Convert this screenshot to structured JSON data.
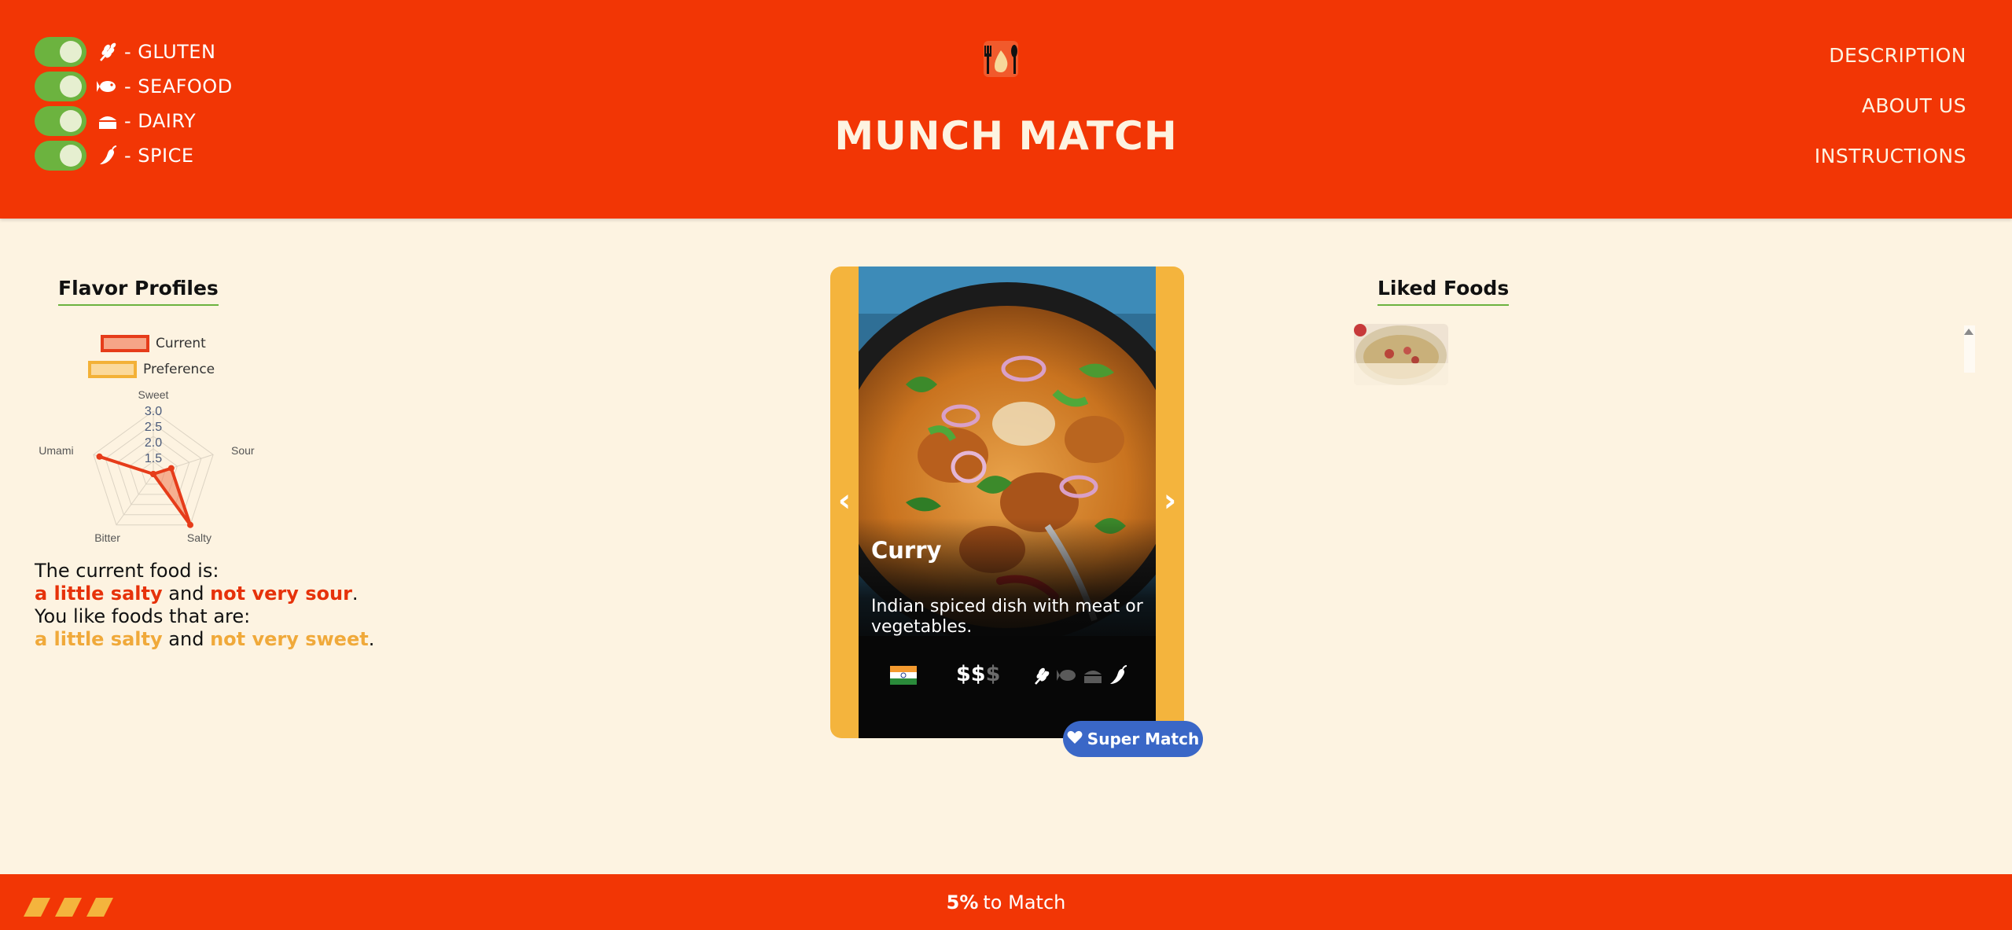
{
  "app": {
    "title": "MUNCH MATCH"
  },
  "allergen_toggles": [
    {
      "label": "- GLUTEN",
      "icon": "wheat-icon",
      "enabled": true
    },
    {
      "label": "- SEAFOOD",
      "icon": "fish-icon",
      "enabled": true
    },
    {
      "label": "- DAIRY",
      "icon": "cheese-icon",
      "enabled": true
    },
    {
      "label": "- SPICE",
      "icon": "pepper-icon",
      "enabled": true
    }
  ],
  "nav": {
    "description": "DESCRIPTION",
    "about_us": "ABOUT US",
    "instructions": "INSTRUCTIONS"
  },
  "flavor_profiles": {
    "title": "Flavor Profiles",
    "legend": {
      "current": "Current",
      "preference": "Preference"
    },
    "summary": {
      "current_intro": "The current food is:",
      "current_trait_1": "a little salty",
      "and_1": " and ",
      "current_trait_2": "not very sour",
      "period_1": ".",
      "pref_intro": "You like foods that are:",
      "pref_trait_1": "a little salty",
      "and_2": " and ",
      "pref_trait_2": "not very sweet",
      "period_2": "."
    }
  },
  "chart_data": {
    "type": "radar",
    "axes": [
      "Sweet",
      "Sour",
      "Salty",
      "Bitter",
      "Umami"
    ],
    "ticks": [
      "1.5",
      "2.0",
      "2.5",
      "3.0"
    ],
    "rmin": 1.0,
    "rmax": 3.0,
    "series": [
      {
        "name": "Current",
        "values": [
          1.0,
          1.6,
          3.0,
          1.0,
          2.8
        ],
        "color": "#e63c1a"
      }
    ]
  },
  "card": {
    "name": "Curry",
    "description": "Indian spiced dish with meat or vegetables.",
    "price_active": "$$",
    "price_dim": "$",
    "origin_flag": "india-flag-icon",
    "prev_arrow": "‹",
    "next_arrow": "›"
  },
  "super_match": {
    "label": "Super Match"
  },
  "liked_foods": {
    "title": "Liked Foods"
  },
  "footer": {
    "percent": "5%",
    "suffix": "to Match"
  },
  "colors": {
    "primary": "#f23605",
    "background": "#fdf3e1",
    "toggle_green": "#6cb33f",
    "card_yellow": "#f4b43d",
    "super_match_blue": "#3a67c7"
  }
}
